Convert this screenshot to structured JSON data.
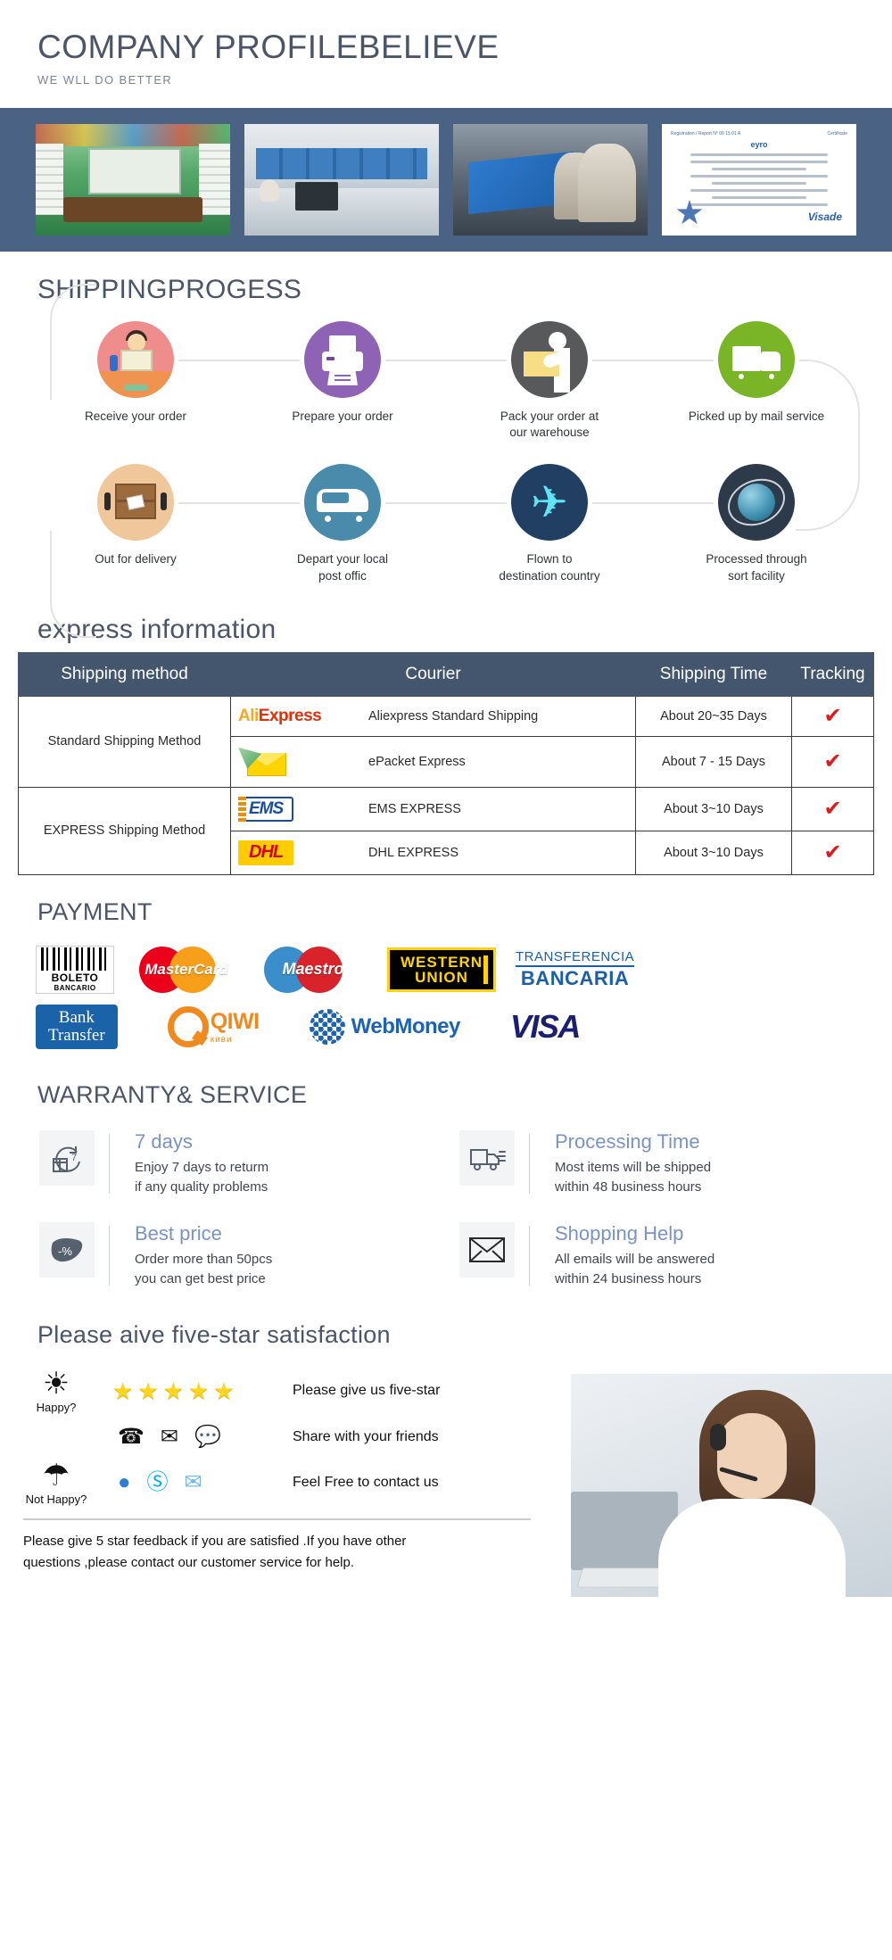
{
  "company": {
    "title": "COMPANY PROFILEBELIEVE",
    "subtitle": "WE WLL DO BETTER",
    "photos": [
      {
        "name": "showroom-photo",
        "alt": "showroom"
      },
      {
        "name": "office-photo",
        "alt": "office"
      },
      {
        "name": "production-line-photo",
        "alt": "production line"
      },
      {
        "name": "certificate-photo",
        "alt": "certificate"
      }
    ],
    "certificate": {
      "brand": "eyro",
      "mark": "Visade",
      "header_left": "Registration / Report N° 00 15 01 A",
      "header_right": "Certificate"
    }
  },
  "shipping_progress": {
    "title": "SHIPPINGPROGESS",
    "steps_row1": [
      {
        "label": "Receive your order",
        "icon": "person-desk-icon",
        "color": "#ef8d8d"
      },
      {
        "label": "Prepare your order",
        "icon": "printer-icon",
        "color": "#8e62b5"
      },
      {
        "label": "Pack your order at\nour warehouse",
        "icon": "worker-box-icon",
        "color": "#58595b"
      },
      {
        "label": "Picked up by mail service",
        "icon": "truck-icon",
        "color": "#7ab528"
      }
    ],
    "steps_row2": [
      {
        "label": "Out for delivery",
        "icon": "mailbox-icon",
        "color": "#f0c79a"
      },
      {
        "label": "Depart your local\npost offic",
        "icon": "van-icon",
        "color": "#4a8bab"
      },
      {
        "label": "Flown to\ndestination country",
        "icon": "airplane-icon",
        "color": "#213e63"
      },
      {
        "label": "Processed through\nsort facility",
        "icon": "globe-sort-icon",
        "color": "#2d3a4a"
      }
    ]
  },
  "express": {
    "title": "express information",
    "headers": [
      "Shipping method",
      "Courier",
      "Shipping Time",
      "Tracking"
    ],
    "rows": [
      {
        "method": "Standard Shipping Method",
        "method_rowspan": 2,
        "logo": "aliexpress-logo",
        "courier": "Aliexpress Standard Shipping",
        "time": "About 20~35 Days",
        "tracking": "✔"
      },
      {
        "method": "",
        "logo": "epacket-logo",
        "courier": "ePacket Express",
        "time": "About 7 - 15 Days",
        "tracking": "✔"
      },
      {
        "method": "EXPRESS Shipping Method",
        "method_rowspan": 2,
        "logo": "ems-logo",
        "courier": "EMS EXPRESS",
        "time": "About 3~10 Days",
        "tracking": "✔"
      },
      {
        "method": "",
        "logo": "dhl-logo",
        "courier": "DHL EXPRESS",
        "time": "About 3~10 Days",
        "tracking": "✔"
      }
    ],
    "logos": {
      "aliexpress": {
        "part1": "Ali",
        "part2": "Express"
      },
      "ems": "EMS",
      "dhl": "DHL"
    }
  },
  "payment": {
    "title": "PAYMENT",
    "row1": [
      {
        "name": "boleto-bancario-logo",
        "l1": "BOLETO",
        "l2": "BANCARIO"
      },
      {
        "name": "mastercard-logo",
        "text": "MasterCard"
      },
      {
        "name": "maestro-logo",
        "text": "Maestro"
      },
      {
        "name": "western-union-logo",
        "l1": "WESTERN",
        "l2": "UNION"
      },
      {
        "name": "transferencia-bancaria-logo",
        "l1": "TRANSFERENCIA",
        "l2": "BANCARIA"
      }
    ],
    "row2": [
      {
        "name": "bank-transfer-logo",
        "l1": "Bank",
        "l2": "Transfer"
      },
      {
        "name": "qiwi-logo",
        "text": "QIWI",
        "sub": "киви"
      },
      {
        "name": "webmoney-logo",
        "text": "WebMoney"
      },
      {
        "name": "visa-logo",
        "text": "VISA"
      }
    ]
  },
  "warranty": {
    "title": "WARRANTY& SERVICE",
    "items": [
      {
        "icon": "return-7-days-icon",
        "heading": "7 days",
        "lines": [
          "Enjoy 7 days to returm",
          "if any quality problems"
        ]
      },
      {
        "icon": "delivery-truck-icon",
        "heading": "Processing Time",
        "lines": [
          "Most items will be shipped",
          "within 48 business hours"
        ]
      },
      {
        "icon": "discount-icon",
        "heading": "Best price",
        "lines": [
          "Order more than 50pcs",
          "you can get best price"
        ]
      },
      {
        "icon": "envelope-icon",
        "heading": "Shopping Help",
        "lines": [
          "All emails will be answered",
          "within 24 business hours"
        ]
      }
    ]
  },
  "five_star": {
    "title": "Please aive five-star satisfaction",
    "happy_label": "Happy?",
    "not_happy_label": "Not Happy?",
    "rows": [
      {
        "face": "happy-sun-icon",
        "face_glyph": "☀",
        "caption": "Happy?",
        "kind": "stars",
        "stars": 5,
        "star_glyph": "★",
        "text": "Please give us five-star"
      },
      {
        "face": "",
        "face_glyph": "",
        "caption": "",
        "kind": "icons",
        "icons": [
          {
            "name": "phone-icon",
            "glyph": "☎"
          },
          {
            "name": "mail-icon",
            "glyph": "✉"
          },
          {
            "name": "chat-bubble-icon",
            "glyph": "💬"
          }
        ],
        "text": "Share with your friends"
      },
      {
        "face": "not-happy-cloud-rain-icon",
        "face_glyph": "☔",
        "caption": "Not Happy?",
        "kind": "icons",
        "icons": [
          {
            "name": "qq-icon",
            "glyph": "●"
          },
          {
            "name": "skype-icon",
            "glyph": "S"
          },
          {
            "name": "email-icon",
            "glyph": "✉"
          }
        ],
        "text": "Feel Free to contact us"
      }
    ],
    "footer_lines": [
      "Please give 5 star feedback if you are satisfied .If you have other",
      "questions ,please contact our customer service for help."
    ]
  },
  "colors": {
    "header_band": "#4a6384",
    "table_header": "#44566e",
    "title_gray": "#4a5568",
    "accent_blue": "#7a93c4",
    "tick_red": "#e01a1a"
  }
}
